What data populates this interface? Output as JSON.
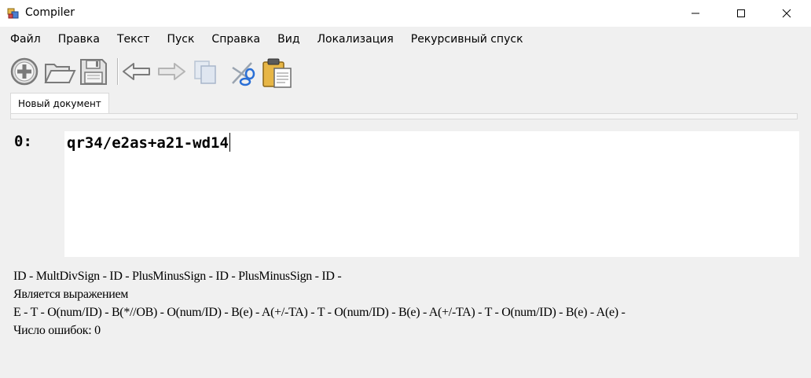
{
  "window": {
    "title": "Compiler",
    "icon": "app-window-icon",
    "controls": [
      "minimize-icon",
      "maximize-icon",
      "close-icon"
    ]
  },
  "menu": {
    "items": [
      {
        "label": "Файл"
      },
      {
        "label": "Правка"
      },
      {
        "label": "Текст"
      },
      {
        "label": "Пуск"
      },
      {
        "label": "Справка"
      },
      {
        "label": "Вид"
      },
      {
        "label": "Локализация"
      },
      {
        "label": "Рекурсивный спуск"
      }
    ]
  },
  "toolbar": {
    "buttons": [
      {
        "icon": "new-file-icon"
      },
      {
        "icon": "open-folder-icon"
      },
      {
        "icon": "save-icon"
      },
      {
        "icon": "undo-icon"
      },
      {
        "icon": "redo-icon"
      },
      {
        "icon": "copy-icon"
      },
      {
        "icon": "cut-icon"
      },
      {
        "icon": "paste-icon"
      }
    ]
  },
  "tabs": [
    {
      "label": "Новый документ",
      "active": true
    }
  ],
  "editor": {
    "line_number": "0:",
    "text": "qr34/e2as+a21-wd14"
  },
  "output": {
    "lines": [
      "ID - MultDivSign - ID - PlusMinusSign - ID - PlusMinusSign - ID -",
      "Является выражением",
      "E - T - O(num/ID) - B(*//OB) - O(num/ID) - B(e) - A(+/-TA) - T - O(num/ID) - B(e) - A(+/-TA) - T - O(num/ID) - B(e) - A(e) -",
      "Число ошибок: 0"
    ]
  }
}
